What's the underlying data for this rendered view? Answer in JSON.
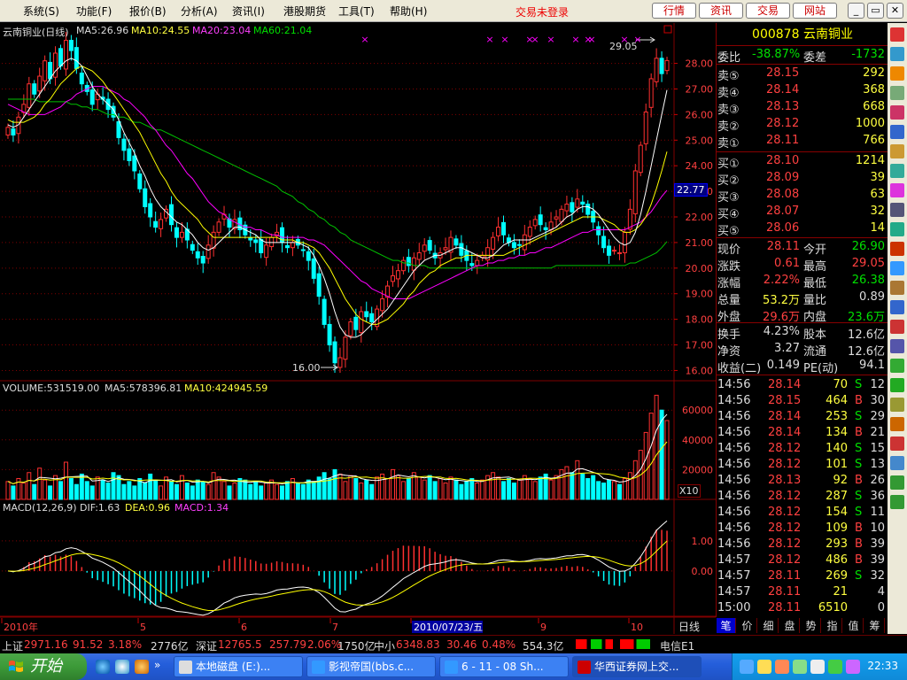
{
  "menu": {
    "items": [
      "系统(S)",
      "功能(F)",
      "报价(B)",
      "分析(A)",
      "资讯(I)",
      "港股期货",
      "工具(T)",
      "帮助(H)"
    ],
    "status": "交易未登录",
    "top_buttons": [
      "行情",
      "资讯",
      "交易",
      "网站"
    ],
    "window_buttons": [
      "_",
      "▭",
      "✕"
    ]
  },
  "chart_header": {
    "name": "云南铜业(日线)",
    "ma5": "MA5:26.96",
    "ma10": "MA10:24.55",
    "ma20": "MA20:23.04",
    "ma60": "MA60:21.04",
    "high_label": "29.05",
    "low_label": "16.00",
    "current_price_tag": "22.77"
  },
  "volume_header": {
    "volume": "VOLUME:531519.00",
    "ma5": "MA5:578396.81",
    "ma10": "MA10:424945.59",
    "unit": "X10"
  },
  "macd_header": {
    "title": "MACD(12,26,9)",
    "dif": "DIF:1.63",
    "dea": "DEA:0.96",
    "macd": "MACD:1.34"
  },
  "chart_data": [
    {
      "type": "candlestick",
      "panel": "price",
      "y_ticks": [
        "28.00",
        "27.00",
        "26.00",
        "25.00",
        "24.00",
        "23.00",
        "22.00",
        "21.00",
        "20.00",
        "19.00",
        "18.00",
        "17.00",
        "16.00"
      ],
      "ylim": [
        15.6,
        29.3
      ],
      "x_labels": [
        "2010年",
        "5",
        "6",
        "7",
        "2010/07/23/五",
        "9",
        "10"
      ],
      "closes": [
        25.5,
        25.2,
        25.9,
        26.4,
        27.2,
        26.8,
        27.5,
        28.1,
        27.4,
        28.4,
        27.9,
        28.9,
        28.5,
        27.8,
        27.2,
        26.9,
        26.4,
        26.8,
        26.6,
        26.2,
        25.9,
        25.1,
        24.6,
        24.2,
        23.8,
        23.1,
        22.4,
        22.0,
        21.6,
        21.9,
        22.3,
        21.7,
        21.2,
        21.4,
        21.1,
        20.7,
        20.4,
        20.2,
        20.9,
        21.4,
        21.8,
        22.1,
        21.6,
        21.9,
        21.5,
        21.3,
        21.1,
        21.0,
        20.6,
        20.9,
        21.2,
        21.4,
        21.0,
        20.8,
        21.0,
        20.9,
        20.7,
        20.3,
        19.6,
        18.9,
        17.8,
        17.0,
        16.3,
        16.5,
        17.3,
        17.9,
        17.6,
        18.3,
        18.1,
        17.9,
        18.4,
        18.8,
        19.3,
        19.7,
        19.9,
        20.3,
        20.1,
        20.4,
        20.6,
        20.9,
        20.7,
        20.4,
        20.6,
        20.8,
        21.2,
        20.9,
        20.5,
        20.3,
        20.1,
        20.3,
        20.5,
        20.8,
        21.2,
        21.6,
        21.3,
        21.0,
        20.8,
        20.9,
        21.3,
        21.6,
        21.9,
        21.7,
        21.5,
        21.8,
        22.0,
        22.3,
        22.5,
        22.2,
        22.7,
        22.5,
        22.1,
        21.8,
        21.3,
        20.8,
        20.5,
        20.7,
        20.6,
        21.4,
        22.3,
        23.8,
        24.8,
        26.1,
        27.4,
        28.2,
        27.6,
        28.11
      ],
      "ma5": [
        25.6,
        25.5,
        25.6,
        25.9,
        26.2,
        26.5,
        26.8,
        27.1,
        27.4,
        27.7,
        27.9,
        28.1,
        28.2,
        28.1,
        27.9,
        27.5,
        27.1,
        26.8,
        26.6,
        26.4,
        26.2,
        25.8,
        25.3,
        24.9,
        24.5,
        24.0,
        23.6,
        23.1,
        22.7,
        22.4,
        22.2,
        22.0,
        21.8,
        21.7,
        21.5,
        21.3,
        21.0,
        20.8,
        20.7,
        20.8,
        21.0,
        21.2,
        21.4,
        21.6,
        21.6,
        21.5,
        21.4,
        21.3,
        21.1,
        21.0,
        21.0,
        21.0,
        21.0,
        21.0,
        21.0,
        21.0,
        20.9,
        20.8,
        20.5,
        20.1,
        19.6,
        19.0,
        18.3,
        17.7,
        17.4,
        17.3,
        17.3,
        17.4,
        17.6,
        17.8,
        18.0,
        18.2,
        18.4,
        18.7,
        19.0,
        19.3,
        19.6,
        19.9,
        20.1,
        20.3,
        20.4,
        20.5,
        20.5,
        20.6,
        20.7,
        20.8,
        20.8,
        20.7,
        20.6,
        20.5,
        20.4,
        20.4,
        20.5,
        20.7,
        20.9,
        21.0,
        21.1,
        21.1,
        21.1,
        21.1,
        21.2,
        21.3,
        21.4,
        21.5,
        21.6,
        21.8,
        22.0,
        22.1,
        22.3,
        22.4,
        22.4,
        22.3,
        22.1,
        21.8,
        21.5,
        21.2,
        21.0,
        20.9,
        21.0,
        21.4,
        22.1,
        23.0,
        24.0,
        25.0,
        26.0,
        26.96
      ],
      "ma10": [
        25.8,
        25.7,
        25.7,
        25.7,
        25.8,
        25.9,
        26.1,
        26.4,
        26.6,
        26.9,
        27.2,
        27.4,
        27.6,
        27.8,
        27.9,
        27.8,
        27.7,
        27.5,
        27.3,
        27.0,
        26.8,
        26.5,
        26.2,
        25.9,
        25.6,
        25.3,
        24.9,
        24.5,
        24.1,
        23.7,
        23.4,
        23.0,
        22.7,
        22.5,
        22.3,
        22.1,
        21.9,
        21.6,
        21.4,
        21.2,
        21.2,
        21.2,
        21.2,
        21.2,
        21.2,
        21.2,
        21.2,
        21.2,
        21.2,
        21.2,
        21.2,
        21.2,
        21.1,
        21.1,
        21.1,
        21.0,
        21.0,
        20.9,
        20.8,
        20.6,
        20.3,
        20.0,
        19.6,
        19.2,
        18.8,
        18.5,
        18.2,
        18.0,
        17.9,
        17.8,
        17.8,
        17.9,
        18.0,
        18.2,
        18.4,
        18.6,
        18.9,
        19.1,
        19.4,
        19.6,
        19.8,
        19.9,
        20.1,
        20.2,
        20.3,
        20.4,
        20.4,
        20.5,
        20.5,
        20.5,
        20.5,
        20.5,
        20.5,
        20.5,
        20.5,
        20.6,
        20.7,
        20.8,
        20.9,
        21.0,
        21.1,
        21.2,
        21.3,
        21.4,
        21.5,
        21.6,
        21.7,
        21.8,
        21.9,
        22.0,
        22.0,
        22.0,
        22.0,
        21.9,
        21.8,
        21.7,
        21.5,
        21.4,
        21.4,
        21.5,
        21.7,
        22.0,
        22.5,
        23.1,
        23.8,
        24.55
      ],
      "ma20": [
        26.4,
        26.3,
        26.2,
        26.1,
        26.0,
        26.0,
        26.0,
        26.0,
        26.1,
        26.2,
        26.3,
        26.5,
        26.6,
        26.8,
        26.9,
        27.0,
        27.1,
        27.1,
        27.1,
        27.0,
        26.9,
        26.8,
        26.6,
        26.5,
        26.3,
        26.1,
        25.9,
        25.6,
        25.4,
        25.1,
        24.8,
        24.6,
        24.3,
        24.0,
        23.7,
        23.5,
        23.2,
        22.9,
        22.6,
        22.4,
        22.2,
        22.1,
        21.9,
        21.8,
        21.7,
        21.6,
        21.6,
        21.5,
        21.5,
        21.4,
        21.3,
        21.3,
        21.2,
        21.2,
        21.2,
        21.2,
        21.2,
        21.1,
        21.1,
        21.0,
        20.9,
        20.7,
        20.5,
        20.3,
        20.1,
        19.9,
        19.7,
        19.5,
        19.4,
        19.2,
        19.1,
        19.0,
        18.9,
        18.8,
        18.8,
        18.8,
        18.8,
        18.9,
        19.0,
        19.1,
        19.2,
        19.3,
        19.4,
        19.5,
        19.6,
        19.7,
        19.8,
        19.9,
        20.0,
        20.1,
        20.1,
        20.2,
        20.2,
        20.3,
        20.3,
        20.4,
        20.4,
        20.5,
        20.5,
        20.6,
        20.6,
        20.7,
        20.8,
        20.8,
        20.9,
        21.0,
        21.1,
        21.2,
        21.3,
        21.4,
        21.4,
        21.5,
        21.5,
        21.5,
        21.5,
        21.5,
        21.5,
        21.5,
        21.6,
        21.7,
        21.8,
        22.0,
        22.2,
        22.5,
        22.8,
        23.04
      ],
      "ma60": [
        26.6,
        26.6,
        26.6,
        26.6,
        26.6,
        26.6,
        26.5,
        26.5,
        26.5,
        26.5,
        26.5,
        26.5,
        26.4,
        26.4,
        26.3,
        26.3,
        26.2,
        26.2,
        26.1,
        26.0,
        26.0,
        25.9,
        25.9,
        25.8,
        25.7,
        25.7,
        25.6,
        25.5,
        25.4,
        25.4,
        25.3,
        25.2,
        25.1,
        25.0,
        24.9,
        24.8,
        24.7,
        24.6,
        24.5,
        24.4,
        24.3,
        24.2,
        24.1,
        24.0,
        23.9,
        23.8,
        23.7,
        23.6,
        23.5,
        23.4,
        23.3,
        23.2,
        23.0,
        22.9,
        22.8,
        22.6,
        22.5,
        22.3,
        22.2,
        22.0,
        21.9,
        21.7,
        21.6,
        21.4,
        21.3,
        21.1,
        21.0,
        20.9,
        20.8,
        20.7,
        20.6,
        20.5,
        20.4,
        20.3,
        20.3,
        20.2,
        20.2,
        20.1,
        20.1,
        20.1,
        20.0,
        20.0,
        20.0,
        20.0,
        20.0,
        20.0,
        20.0,
        20.0,
        20.0,
        20.0,
        20.0,
        20.0,
        20.0,
        20.0,
        20.0,
        20.0,
        20.0,
        20.0,
        20.0,
        20.0,
        20.0,
        20.0,
        20.0,
        20.0,
        20.1,
        20.1,
        20.1,
        20.1,
        20.1,
        20.1,
        20.1,
        20.1,
        20.1,
        20.1,
        20.1,
        20.1,
        20.1,
        20.1,
        20.2,
        20.2,
        20.3,
        20.4,
        20.5,
        20.6,
        20.8,
        21.04
      ]
    },
    {
      "type": "bar",
      "panel": "volume",
      "y_ticks": [
        "60000",
        "40000",
        "20000"
      ],
      "ylim": [
        0,
        75000
      ],
      "values": [
        12000,
        9000,
        14000,
        11000,
        18000,
        10000,
        21000,
        13000,
        9000,
        16000,
        12000,
        25000,
        14000,
        10000,
        17000,
        12000,
        9000,
        15000,
        13000,
        11000,
        18000,
        16000,
        10000,
        12000,
        9000,
        14000,
        11000,
        17000,
        13000,
        9000,
        15000,
        12000,
        10000,
        16000,
        11000,
        9000,
        13000,
        12000,
        10000,
        18000,
        15000,
        12000,
        9000,
        11000,
        14000,
        13000,
        10000,
        12000,
        9000,
        11000,
        13000,
        10000,
        9000,
        12000,
        14000,
        11000,
        10000,
        13000,
        12000,
        15000,
        18000,
        14000,
        20000,
        17000,
        12000,
        16000,
        14000,
        11000,
        13000,
        10000,
        15000,
        17000,
        14000,
        20000,
        16000,
        12000,
        14000,
        18000,
        15000,
        13000,
        16000,
        12000,
        14000,
        11000,
        15000,
        13000,
        10000,
        12000,
        14000,
        11000,
        13000,
        16000,
        18000,
        15000,
        12000,
        14000,
        11000,
        13000,
        16000,
        14000,
        12000,
        15000,
        17000,
        13000,
        16000,
        20000,
        22000,
        18000,
        26000,
        17000,
        14000,
        16000,
        12000,
        11000,
        13000,
        12000,
        10000,
        14000,
        18000,
        26000,
        33000,
        45000,
        58000,
        70000,
        60000,
        53000
      ],
      "up": [
        1,
        0,
        1,
        1,
        1,
        0,
        1,
        1,
        0,
        1,
        0,
        1,
        0,
        0,
        0,
        0,
        0,
        1,
        0,
        0,
        0,
        0,
        0,
        0,
        0,
        0,
        0,
        0,
        0,
        1,
        1,
        0,
        0,
        1,
        0,
        0,
        0,
        0,
        1,
        1,
        1,
        1,
        0,
        1,
        0,
        0,
        0,
        0,
        0,
        1,
        1,
        1,
        0,
        0,
        1,
        0,
        0,
        0,
        0,
        0,
        0,
        0,
        0,
        1,
        1,
        1,
        0,
        1,
        0,
        0,
        1,
        1,
        1,
        1,
        1,
        1,
        0,
        1,
        1,
        1,
        0,
        0,
        1,
        1,
        1,
        0,
        0,
        0,
        0,
        1,
        1,
        1,
        1,
        1,
        0,
        0,
        0,
        1,
        1,
        1,
        1,
        0,
        0,
        1,
        1,
        1,
        1,
        0,
        1,
        0,
        0,
        0,
        0,
        0,
        0,
        1,
        0,
        1,
        1,
        1,
        1,
        1,
        1,
        1,
        0,
        1
      ]
    },
    {
      "type": "line",
      "panel": "macd",
      "y_ticks": [
        "1.00",
        "0.00"
      ],
      "ylim": [
        -1.5,
        2.2
      ],
      "dif_end": 1.63,
      "dea_end": 0.96,
      "macd_end": 1.34
    }
  ],
  "quote": {
    "title": "000878 云南铜业",
    "code": "000878",
    "name": "云南铜业",
    "weibi_label": "委比",
    "weibi": "-38.87%",
    "weicha_label": "委差",
    "weicha": "-1732",
    "asks": [
      {
        "label": "卖⑤",
        "price": "28.15",
        "vol": "292"
      },
      {
        "label": "卖④",
        "price": "28.14",
        "vol": "368"
      },
      {
        "label": "卖③",
        "price": "28.13",
        "vol": "668"
      },
      {
        "label": "卖②",
        "price": "28.12",
        "vol": "1000"
      },
      {
        "label": "卖①",
        "price": "28.11",
        "vol": "766"
      }
    ],
    "bids": [
      {
        "label": "买①",
        "price": "28.10",
        "vol": "1214"
      },
      {
        "label": "买②",
        "price": "28.09",
        "vol": "39"
      },
      {
        "label": "买③",
        "price": "28.08",
        "vol": "63"
      },
      {
        "label": "买④",
        "price": "28.07",
        "vol": "32"
      },
      {
        "label": "买⑤",
        "price": "28.06",
        "vol": "14"
      }
    ],
    "stats": [
      {
        "l1": "现价",
        "v1": "28.11",
        "c1": "r",
        "l2": "今开",
        "v2": "26.90",
        "c2": "g"
      },
      {
        "l1": "涨跌",
        "v1": "0.61",
        "c1": "r",
        "l2": "最高",
        "v2": "29.05",
        "c2": "r"
      },
      {
        "l1": "涨幅",
        "v1": "2.22%",
        "c1": "r",
        "l2": "最低",
        "v2": "26.38",
        "c2": "g"
      },
      {
        "l1": "总量",
        "v1": "53.2万",
        "c1": "y",
        "l2": "量比",
        "v2": "0.89",
        "c2": "w"
      },
      {
        "l1": "外盘",
        "v1": "29.6万",
        "c1": "r",
        "l2": "内盘",
        "v2": "23.6万",
        "c2": "g"
      }
    ],
    "fin": [
      {
        "l1": "换手",
        "v1": "4.23%",
        "l2": "股本",
        "v2": "12.6亿"
      },
      {
        "l1": "净资",
        "v1": "3.27",
        "l2": "流通",
        "v2": "12.6亿"
      },
      {
        "l1": "收益(二)",
        "v1": "0.149",
        "l2": "PE(动)",
        "v2": "94.1"
      }
    ],
    "ticks": [
      {
        "t": "14:56",
        "p": "28.14",
        "v": "70",
        "d": "S",
        "n": "12"
      },
      {
        "t": "14:56",
        "p": "28.15",
        "v": "464",
        "d": "B",
        "n": "30"
      },
      {
        "t": "14:56",
        "p": "28.14",
        "v": "253",
        "d": "S",
        "n": "29"
      },
      {
        "t": "14:56",
        "p": "28.14",
        "v": "134",
        "d": "B",
        "n": "21"
      },
      {
        "t": "14:56",
        "p": "28.12",
        "v": "140",
        "d": "S",
        "n": "15"
      },
      {
        "t": "14:56",
        "p": "28.12",
        "v": "101",
        "d": "S",
        "n": "13"
      },
      {
        "t": "14:56",
        "p": "28.13",
        "v": "92",
        "d": "B",
        "n": "26"
      },
      {
        "t": "14:56",
        "p": "28.12",
        "v": "287",
        "d": "S",
        "n": "36"
      },
      {
        "t": "14:56",
        "p": "28.12",
        "v": "154",
        "d": "S",
        "n": "11"
      },
      {
        "t": "14:56",
        "p": "28.12",
        "v": "109",
        "d": "B",
        "n": "10"
      },
      {
        "t": "14:56",
        "p": "28.12",
        "v": "293",
        "d": "B",
        "n": "39"
      },
      {
        "t": "14:57",
        "p": "28.12",
        "v": "486",
        "d": "B",
        "n": "39"
      },
      {
        "t": "14:57",
        "p": "28.11",
        "v": "269",
        "d": "S",
        "n": "32"
      },
      {
        "t": "14:57",
        "p": "28.11",
        "v": "21",
        "d": "",
        "n": "4"
      },
      {
        "t": "15:00",
        "p": "28.11",
        "v": "6510",
        "d": "",
        "n": "0"
      }
    ],
    "tabs": [
      "笔",
      "价",
      "细",
      "盘",
      "势",
      "指",
      "值",
      "筹"
    ]
  },
  "period_label": "日线",
  "indexbar": {
    "sh_label": "上证",
    "sh_value": "2971.16",
    "sh_change": "91.52",
    "sh_pct": "3.18%",
    "sh_amount": "2776亿",
    "sz_label": "深证",
    "sz_value": "12765.5",
    "sz_change": "257.79",
    "sz_pct": "2.06%",
    "sz_amount": "1750亿",
    "zx_label": "中小",
    "zx_value": "6348.83",
    "zx_change": "30.46",
    "zx_pct": "0.48%",
    "zx_amount": "554.3亿",
    "server": "电信E1"
  },
  "taskbar": {
    "start": "开始",
    "tasks": [
      "本地磁盘 (E:)...",
      "影视帝国(bbs.c...",
      "6 - 11 - 08 Sh...",
      "华西证券网上交..."
    ],
    "clock": "22:33"
  },
  "colors": {
    "up": "#ff3030",
    "down": "#00ffff",
    "ma5": "#ffffff",
    "ma10": "#ffff00",
    "ma20": "#ff00ff",
    "ma60": "#00c000",
    "grid": "#800000"
  }
}
